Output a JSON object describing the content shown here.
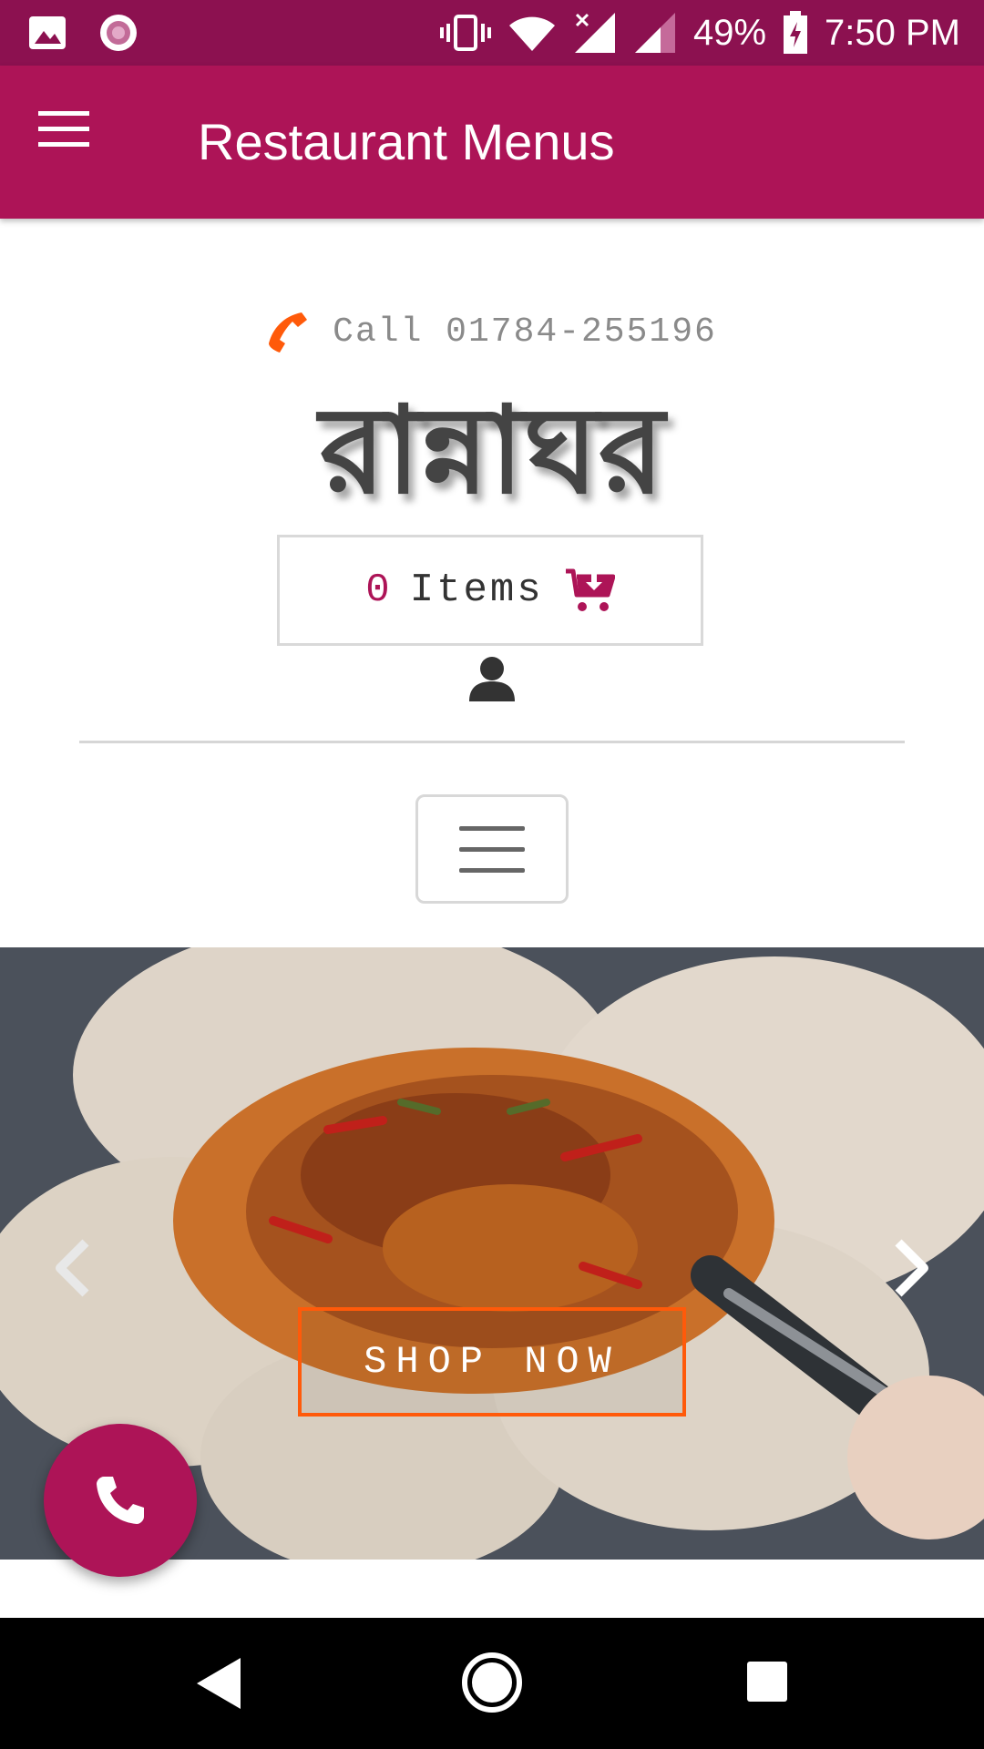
{
  "status_bar": {
    "battery": "49%",
    "time": "7:50 PM",
    "icons": [
      "gallery-icon",
      "record-icon",
      "vibrate-icon",
      "wifi-icon",
      "signal-x-icon",
      "signal-icon",
      "battery-charging-icon"
    ]
  },
  "app_bar": {
    "title": "Restaurant Menus",
    "menu_icon": "hamburger-menu-icon"
  },
  "header": {
    "call_text": "Call 01784-255196",
    "phone_icon": "phone-icon",
    "brand_name": "রান্নাঘর"
  },
  "cart": {
    "count": "0",
    "label": "Items",
    "icon": "cart-download-icon"
  },
  "account": {
    "icon": "user-icon"
  },
  "nav_toggle": {
    "icon": "hamburger-icon"
  },
  "hero": {
    "button_label": "SHOP NOW",
    "prev_icon": "chevron-left-icon",
    "next_icon": "chevron-right-icon"
  },
  "fab": {
    "icon": "phone-icon"
  },
  "system_nav": [
    "back-icon",
    "home-icon",
    "recents-icon"
  ],
  "colors": {
    "status_bar": "#8c1150",
    "app_bar": "#ad1457",
    "accent": "#ff5a0a",
    "cart_count": "#ad1457"
  }
}
